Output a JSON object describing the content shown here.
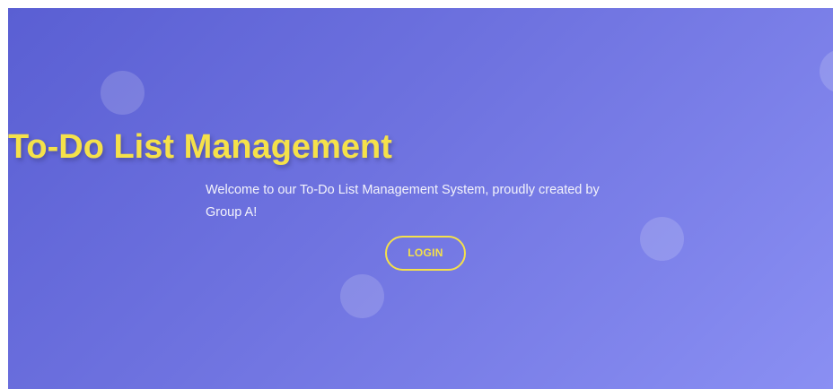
{
  "hero": {
    "title": "To-Do List Management",
    "subtitle": "Welcome to our To-Do List Management System, proudly created by Group A!",
    "login_label": "LOGIN"
  },
  "colors": {
    "gradient_start": "#5a5fd3",
    "gradient_end": "#8a8ff3",
    "accent": "#f5e14a",
    "text_light": "#f3f3fb"
  }
}
